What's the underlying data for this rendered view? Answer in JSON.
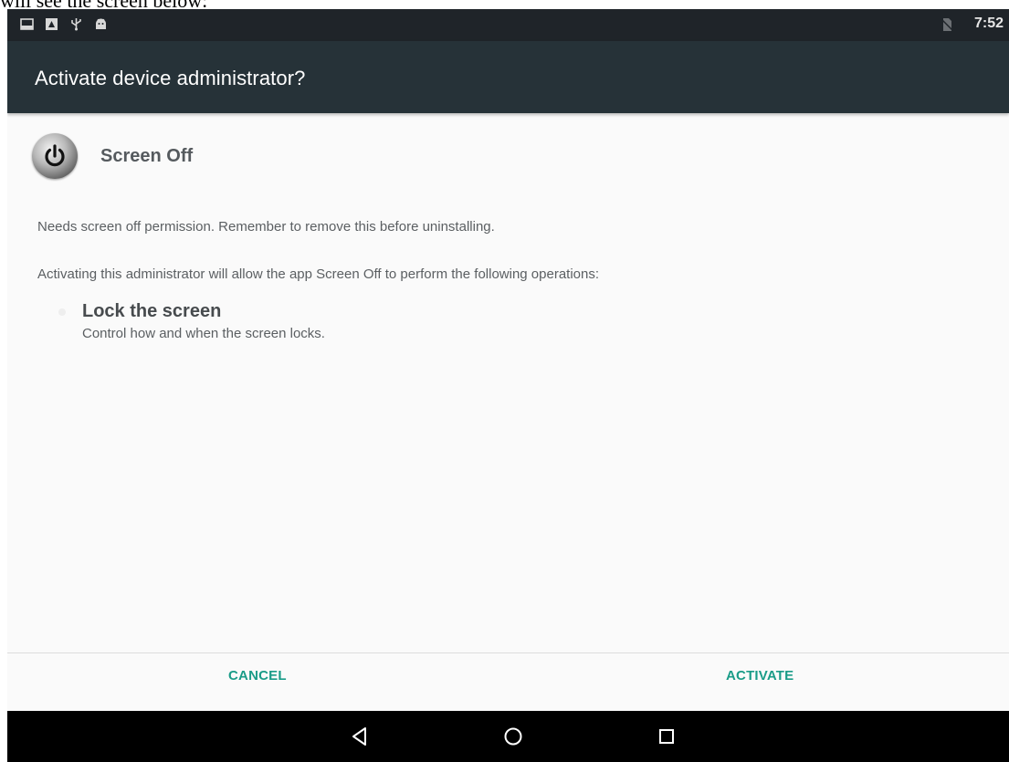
{
  "doc_caption": "will see the screen below:",
  "status_bar": {
    "time": "7:52",
    "left_icons": [
      "screenshot-icon",
      "notification-icon",
      "usb-icon",
      "android-icon"
    ],
    "right_icons": [
      "no-sim-icon"
    ]
  },
  "dialog": {
    "title": "Activate device administrator?",
    "app_icon": "power-icon",
    "app_name": "Screen Off",
    "description": "Needs screen off permission. Remember to remove this before uninstalling.",
    "activating_text": "Activating this administrator will allow the app Screen Off to perform the following operations:",
    "permissions": [
      {
        "title": "Lock the screen",
        "subtitle": "Control how and when the screen locks."
      }
    ],
    "buttons": {
      "cancel": "CANCEL",
      "activate": "ACTIVATE"
    }
  },
  "nav_bar": {
    "icons": [
      "back-icon",
      "home-icon",
      "recents-icon"
    ]
  },
  "colors": {
    "accent": "#1a9c88",
    "title_bar": "#263238",
    "status_bar": "#1f2429",
    "nav_bar": "#000000"
  }
}
